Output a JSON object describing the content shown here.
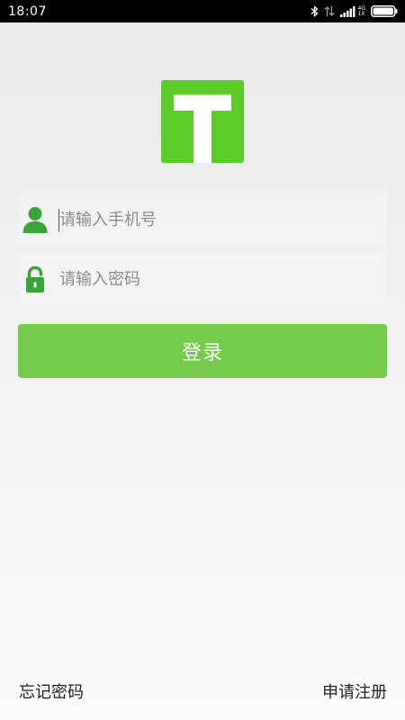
{
  "status_bar": {
    "time": "18:07",
    "network_label_top": "4G",
    "network_label_bottom": "1X",
    "icons": [
      "bluetooth-icon",
      "data-transfer-icon",
      "signal-icon",
      "battery-icon"
    ]
  },
  "logo": {
    "letter_shape": "T",
    "color": "#5ccc28"
  },
  "login_form": {
    "phone": {
      "placeholder": "请输入手机号",
      "value": "",
      "icon": "user-icon"
    },
    "password": {
      "placeholder": "请输入密码",
      "value": "",
      "icon": "lock-icon"
    },
    "login_label": "登录"
  },
  "footer": {
    "forgot_password": "忘记密码",
    "register": "申请注册"
  },
  "colors": {
    "accent": "#5ccc28",
    "button": "#74cb4c",
    "icon": "#3aa33a"
  }
}
